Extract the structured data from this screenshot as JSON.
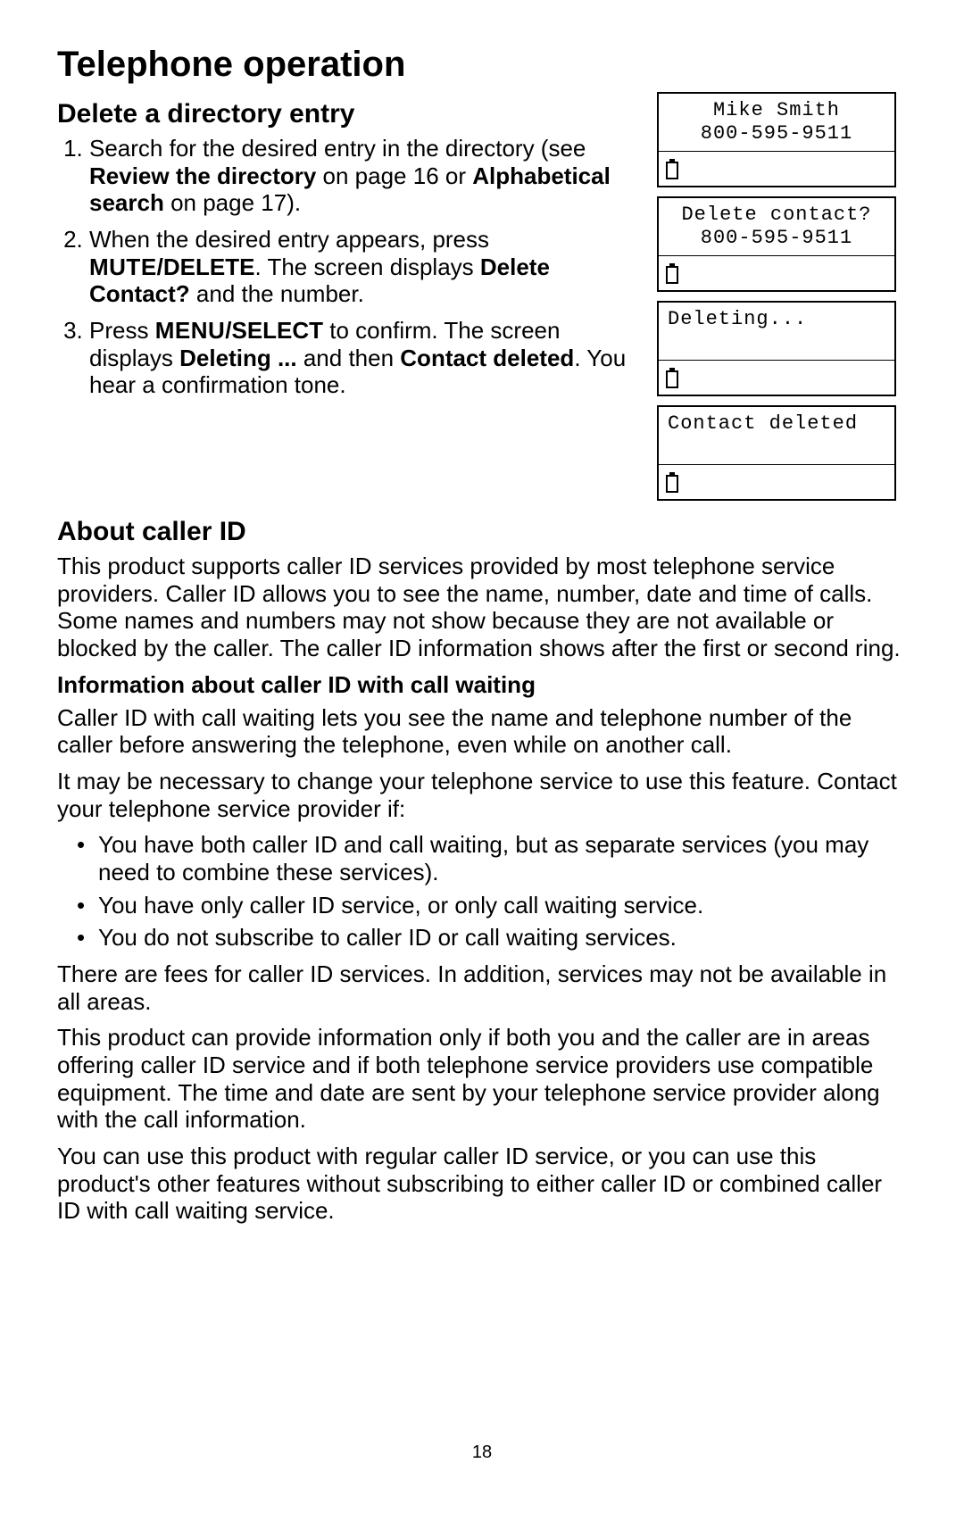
{
  "page_number": "18",
  "title": "Telephone operation",
  "delete_section": {
    "heading": "Delete a directory entry",
    "step1": {
      "pre": "Search for the desired entry in the directory (see ",
      "b1": "Review the directory",
      "mid": " on page 16 or ",
      "b2": "Alphabetical search",
      "post": " on page 17)."
    },
    "step2": {
      "pre": "When the desired entry appears, press ",
      "sc": "MUTE",
      "b1": "/DELETE",
      "mid": ". The screen displays ",
      "b2": "Delete Contact?",
      "post": " and the number."
    },
    "step3": {
      "pre": "Press ",
      "sc": "MENU",
      "b1": "/SELECT",
      "mid": " to confirm. The screen displays ",
      "b2": "Deleting ...",
      "mid2": " and then ",
      "b3": "Contact deleted",
      "post": ". You hear a confirmation tone."
    }
  },
  "lcd_screens": [
    {
      "line1": "Mike Smith",
      "line2": "800-595-9511",
      "align": "center"
    },
    {
      "line1": "Delete contact?",
      "line2": "800-595-9511",
      "align": "center"
    },
    {
      "line1": "Deleting...",
      "line2": "",
      "align": "left"
    },
    {
      "line1": "Contact deleted",
      "line2": "",
      "align": "left"
    }
  ],
  "about_section": {
    "heading": "About caller ID",
    "p1": "This product supports caller ID services provided by most telephone service providers. Caller ID allows you to see the name, number, date and time of calls. Some names and numbers may not show because they are not available or blocked by the caller. The caller ID information shows after the first or second ring.",
    "sub_heading": "Information about caller ID with call waiting",
    "p2": "Caller ID with call waiting lets you see the name and telephone number of the caller before answering the telephone, even while on another call.",
    "p3": "It may be necessary to change your telephone service to use this feature. Contact your telephone service provider if:",
    "bullets": [
      "You have both caller ID and call waiting, but as separate services (you may need to combine these services).",
      "You have only caller ID service, or only call waiting service.",
      "You do not subscribe to caller ID or call waiting services."
    ],
    "p4": "There are fees for caller ID services. In addition, services may not be available in all areas.",
    "p5": "This product can provide information only if both you and the caller are in areas offering caller ID service and if both telephone service providers use compatible equipment. The time and date are sent by your telephone service provider along with the call information.",
    "p6": "You can use this product with regular caller ID service, or you can use this product's other features without subscribing to either caller ID or combined caller ID with call waiting service."
  }
}
